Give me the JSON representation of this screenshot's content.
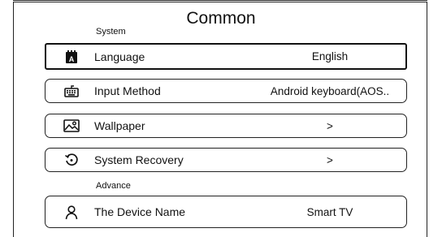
{
  "page": {
    "title": "Common"
  },
  "sections": {
    "system_label": "System",
    "advance_label": "Advance"
  },
  "rows": [
    {
      "label": "Language",
      "value": "English",
      "icon": "language-icon"
    },
    {
      "label": "Input Method",
      "value": "Android keyboard(AOS..",
      "icon": "keyboard-icon"
    },
    {
      "label": "Wallpaper",
      "value": ">",
      "icon": "wallpaper-icon"
    },
    {
      "label": "System Recovery",
      "value": ">",
      "icon": "recovery-icon"
    },
    {
      "label": "The Device Name",
      "value": "Smart TV",
      "icon": "user-icon"
    }
  ]
}
